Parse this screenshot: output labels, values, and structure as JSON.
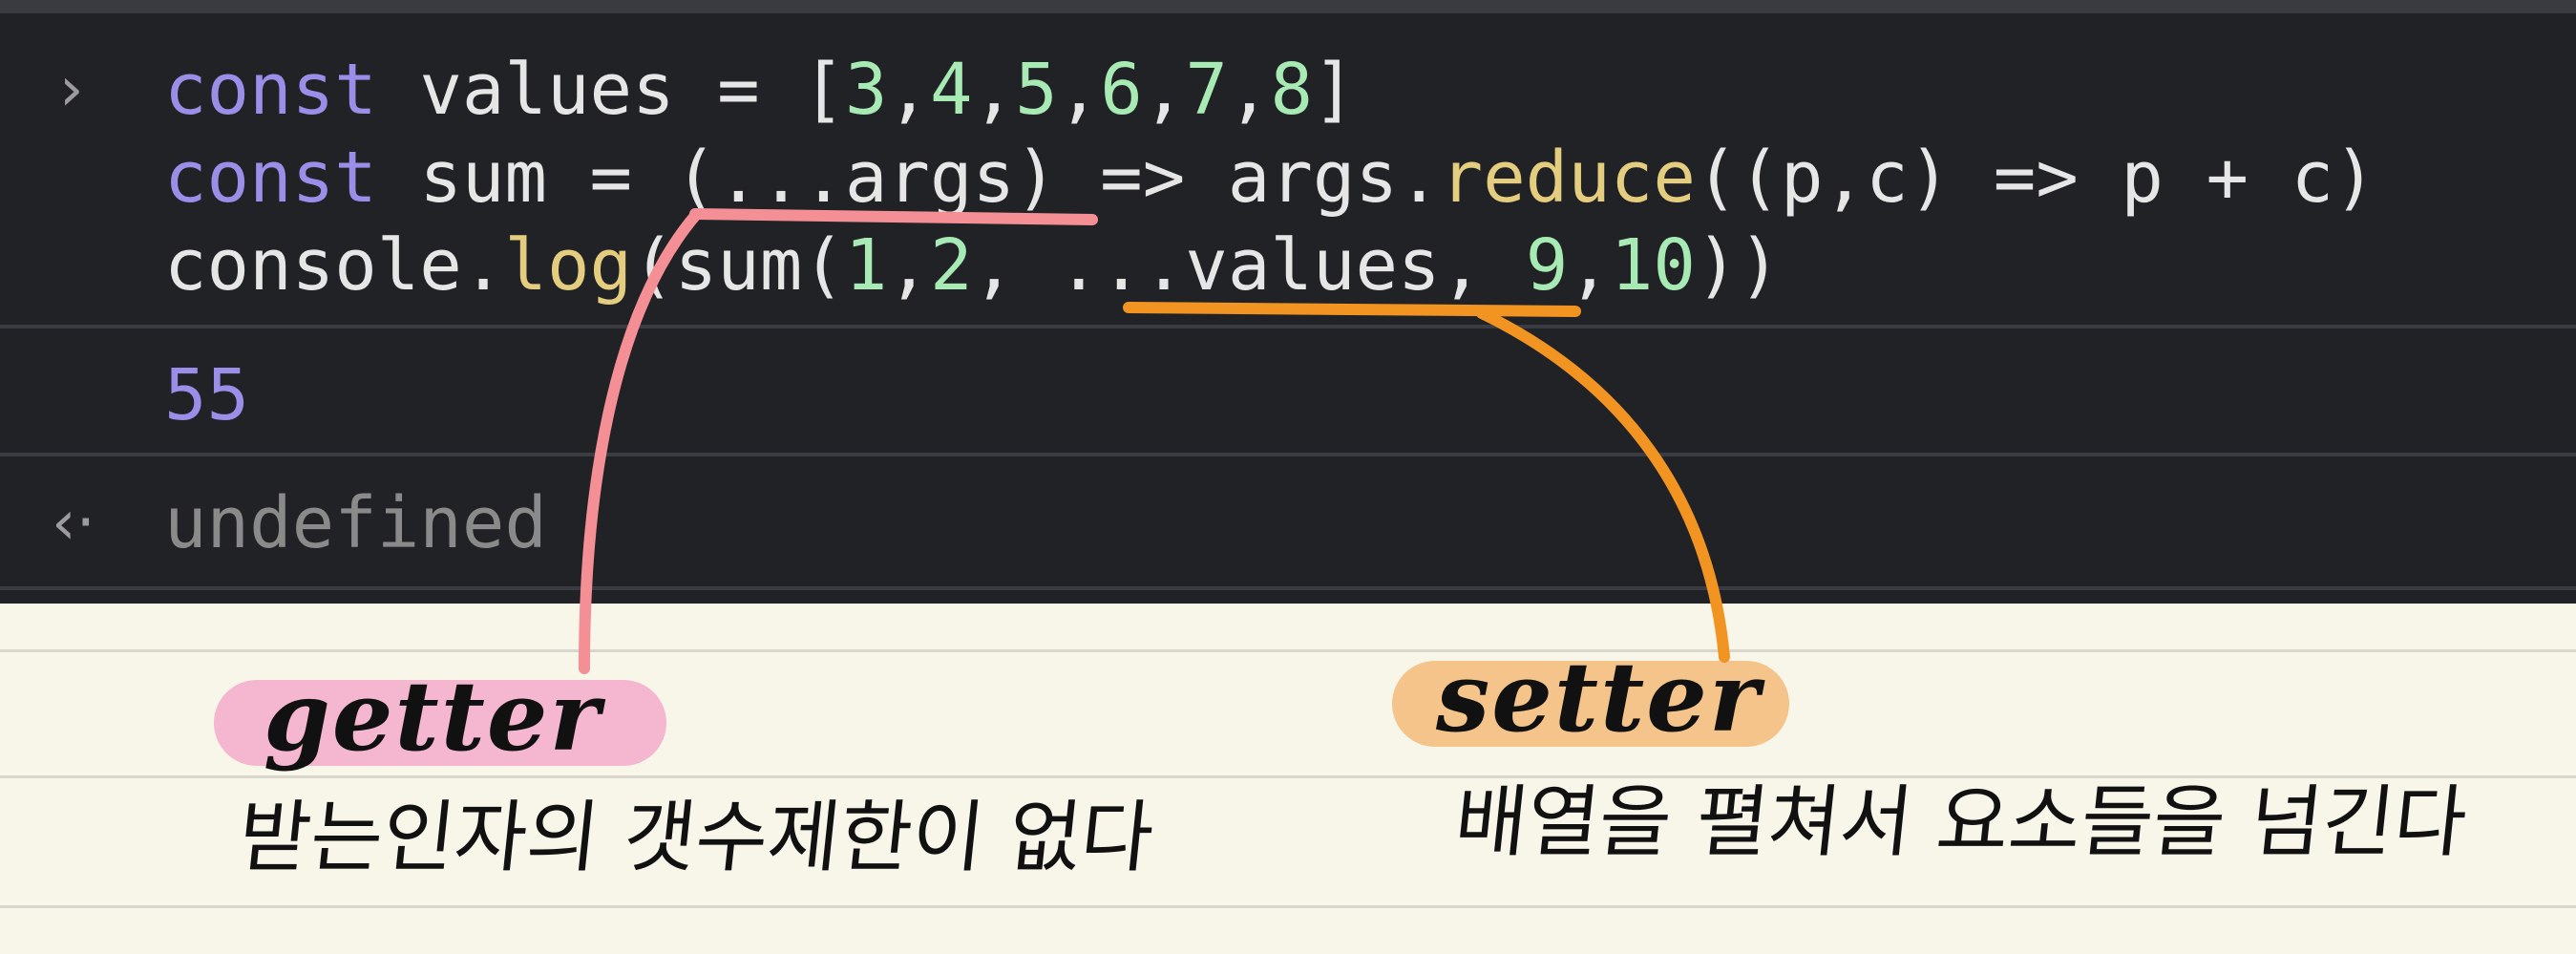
{
  "console": {
    "input_lines": [
      [
        {
          "t": "const",
          "c": "kw"
        },
        {
          "t": " values = [",
          "c": "plain"
        },
        {
          "t": "3",
          "c": "num"
        },
        {
          "t": ",",
          "c": "plain"
        },
        {
          "t": "4",
          "c": "num"
        },
        {
          "t": ",",
          "c": "plain"
        },
        {
          "t": "5",
          "c": "num"
        },
        {
          "t": ",",
          "c": "plain"
        },
        {
          "t": "6",
          "c": "num"
        },
        {
          "t": ",",
          "c": "plain"
        },
        {
          "t": "7",
          "c": "num"
        },
        {
          "t": ",",
          "c": "plain"
        },
        {
          "t": "8",
          "c": "num"
        },
        {
          "t": "]",
          "c": "plain"
        }
      ],
      [
        {
          "t": "const",
          "c": "kw"
        },
        {
          "t": " sum = (...args) => args.",
          "c": "plain"
        },
        {
          "t": "reduce",
          "c": "fn"
        },
        {
          "t": "((p,c) => p + c)",
          "c": "plain"
        }
      ],
      [
        {
          "t": "console.",
          "c": "plain"
        },
        {
          "t": "log",
          "c": "fn"
        },
        {
          "t": "(sum(",
          "c": "plain"
        },
        {
          "t": "1",
          "c": "num"
        },
        {
          "t": ",",
          "c": "plain"
        },
        {
          "t": "2",
          "c": "num"
        },
        {
          "t": ", ...values, ",
          "c": "plain"
        },
        {
          "t": "9",
          "c": "num"
        },
        {
          "t": ",",
          "c": "plain"
        },
        {
          "t": "10",
          "c": "num"
        },
        {
          "t": "))",
          "c": "plain"
        }
      ]
    ],
    "prompt_symbol": "›",
    "output_value": "55",
    "return_symbol": "‹·",
    "return_value": "undefined"
  },
  "notes": {
    "getter": {
      "label": "getter",
      "description": "받는인자의 갯수제한이 없다",
      "color": "#f5b6cf",
      "line_color": "#f48f95"
    },
    "setter": {
      "label": "setter",
      "description": "배열을 펼쳐서 요소들을 넘긴다",
      "color": "#f4c48a",
      "line_color": "#f19421"
    }
  },
  "colors": {
    "console_bg": "#212226",
    "notes_bg": "#f8f6e9",
    "keyword": "#9a8ee8",
    "number": "#a7eab4",
    "function": "#e5cd7f"
  }
}
